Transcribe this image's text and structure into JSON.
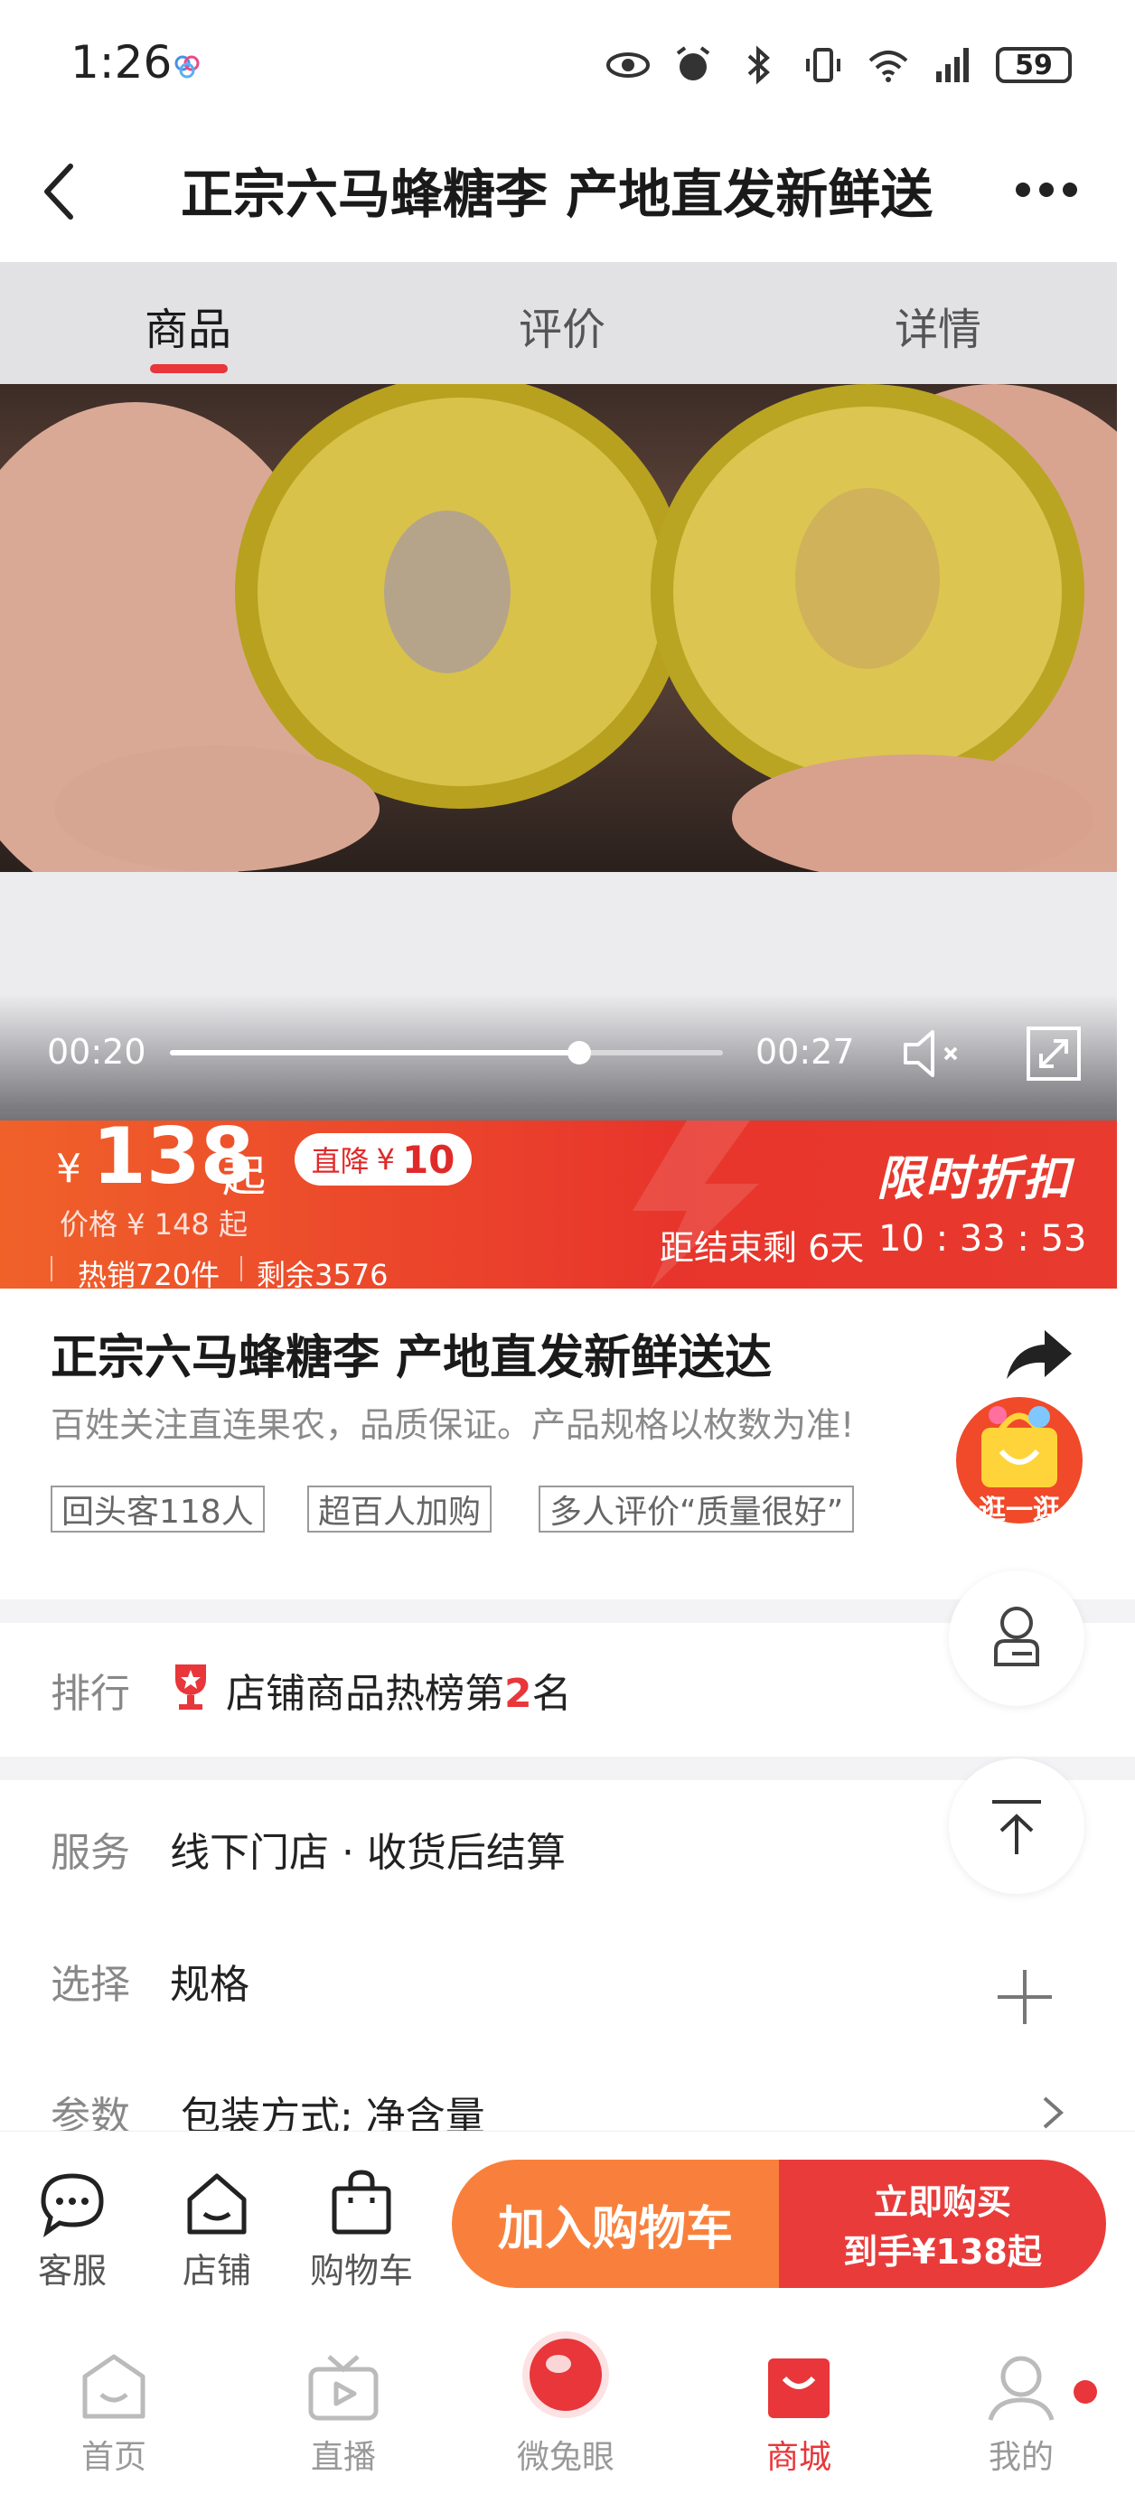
{
  "status_bar": {
    "time": "1:26",
    "battery": "59"
  },
  "nav": {
    "title": "正宗六马蜂糖李 产地直发新鲜送"
  },
  "media_tabs": [
    {
      "label": "商品",
      "active": true
    },
    {
      "label": "评价",
      "active": false
    },
    {
      "label": "详情",
      "active": false
    }
  ],
  "video": {
    "current_time": "00:20",
    "total_time": "00:27",
    "progress": 0.74
  },
  "price_banner": {
    "currency": "¥",
    "price": "138",
    "price_suffix": "起",
    "drop_label": "直降",
    "drop_currency": "¥",
    "drop_amount": "10",
    "original_price": "价格 ¥ 148 起",
    "sales": "热销720件",
    "remaining": "剩余3576",
    "flash_title": "限时折扣",
    "countdown_label": "距结束剩 6天",
    "countdown": "10 : 33 : 53"
  },
  "product": {
    "title": "正宗六马蜂糖李 产地直发新鲜送达",
    "subtitle": "百姓关注直连果农，品质保证。产品规格以枚数为准!",
    "tags": [
      "回头客118人",
      "超百人加购",
      "多人评价“质量很好”"
    ],
    "promo_label": "逛一逛"
  },
  "rank": {
    "label": "排行",
    "prefix": "店铺商品热榜第",
    "number": "2",
    "suffix": "名"
  },
  "rows": {
    "service": {
      "label": "服务",
      "value": "线下门店 · 收货后结算"
    },
    "select": {
      "label": "选择",
      "value": "规格"
    },
    "params": {
      "label": "参数",
      "value": "包装方式; 净含量"
    }
  },
  "actions": {
    "service": "客服",
    "store": "店铺",
    "cart": "购物车",
    "add_to_cart": "加入购物车",
    "buy_now_line1": "立即购买",
    "buy_now_line2": "到手¥138起"
  },
  "tabbar": [
    {
      "label": "首页",
      "icon": "home-face-icon"
    },
    {
      "label": "直播",
      "icon": "tv-play-icon"
    },
    {
      "label": "微兔眼",
      "icon": "red-orb-icon"
    },
    {
      "label": "商城",
      "icon": "shopping-bag-icon",
      "active": true
    },
    {
      "label": "我的",
      "icon": "person-icon"
    }
  ],
  "colors": {
    "accent": "#e8363a",
    "orange": "#f9803c",
    "banner_start": "#f0612a",
    "banner_end": "#e8352c"
  }
}
